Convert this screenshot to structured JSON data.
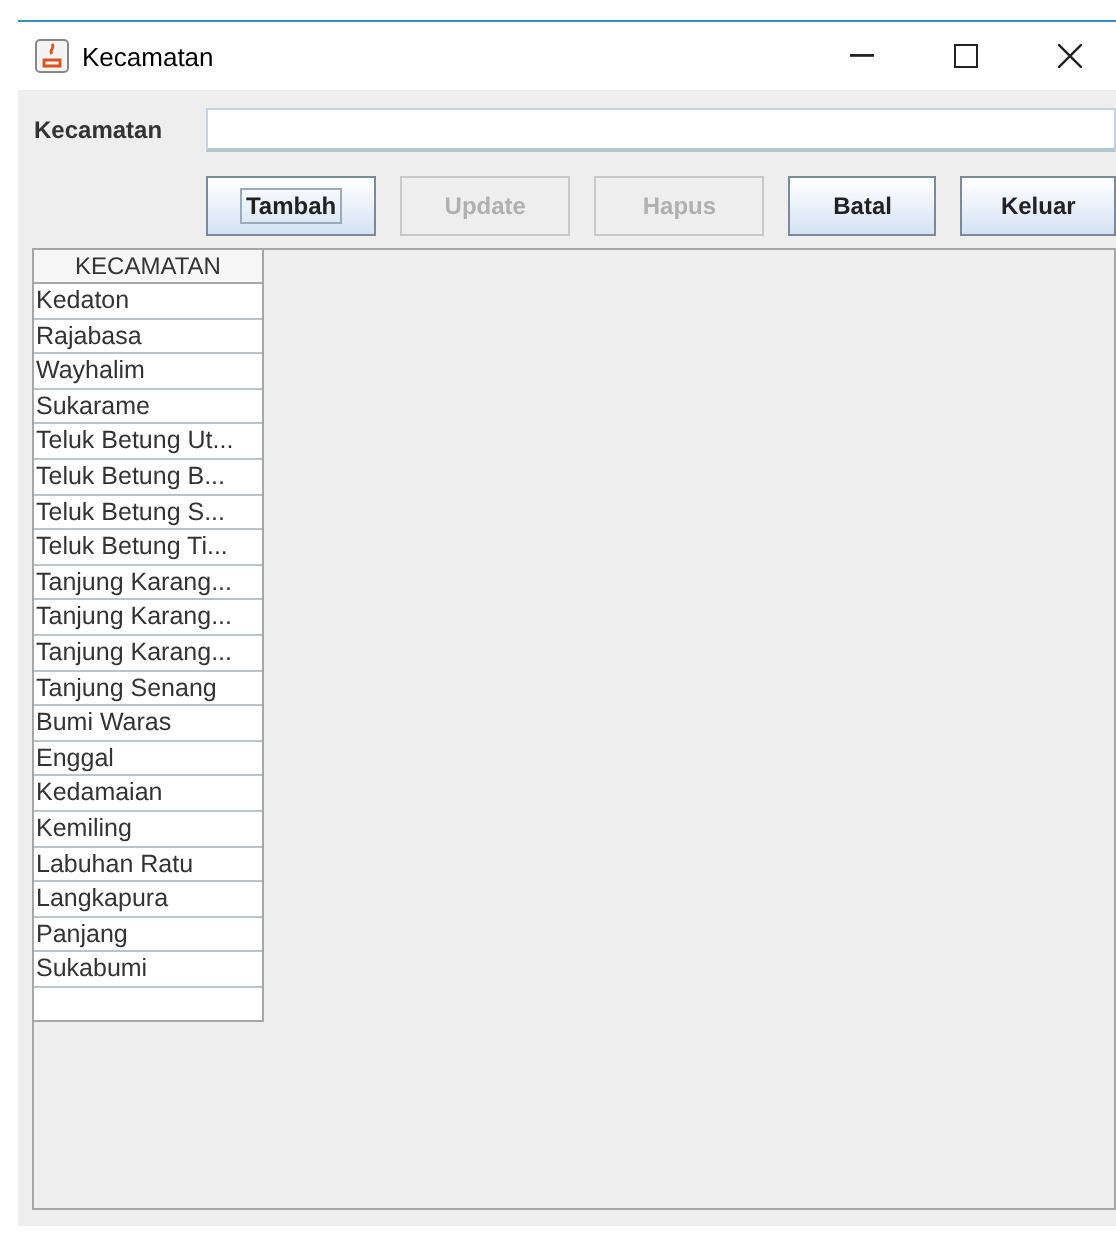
{
  "window": {
    "title": "Kecamatan"
  },
  "form": {
    "label": "Kecamatan"
  },
  "buttons": [
    {
      "label": "Tambah",
      "disabled": false,
      "focused": true
    },
    {
      "label": "Update",
      "disabled": true,
      "focused": false
    },
    {
      "label": "Hapus",
      "disabled": true,
      "focused": false
    },
    {
      "label": "Batal",
      "disabled": false,
      "focused": false
    },
    {
      "label": "Keluar",
      "disabled": false,
      "focused": false
    }
  ],
  "table": {
    "columns": [
      "KECAMATAN"
    ],
    "rows": [
      "Kedaton",
      "Rajabasa",
      "Wayhalim",
      "Sukarame",
      "Teluk Betung Ut...",
      "Teluk Betung B...",
      "Teluk Betung S...",
      "Teluk Betung Ti...",
      "Tanjung Karang...",
      "Tanjung Karang...",
      "Tanjung Karang...",
      "Tanjung Senang",
      "Bumi Waras",
      "Enggal",
      "Kedamaian",
      "Kemiling",
      "Labuhan Ratu",
      "Langkapura",
      "Panjang",
      "Sukabumi"
    ]
  }
}
